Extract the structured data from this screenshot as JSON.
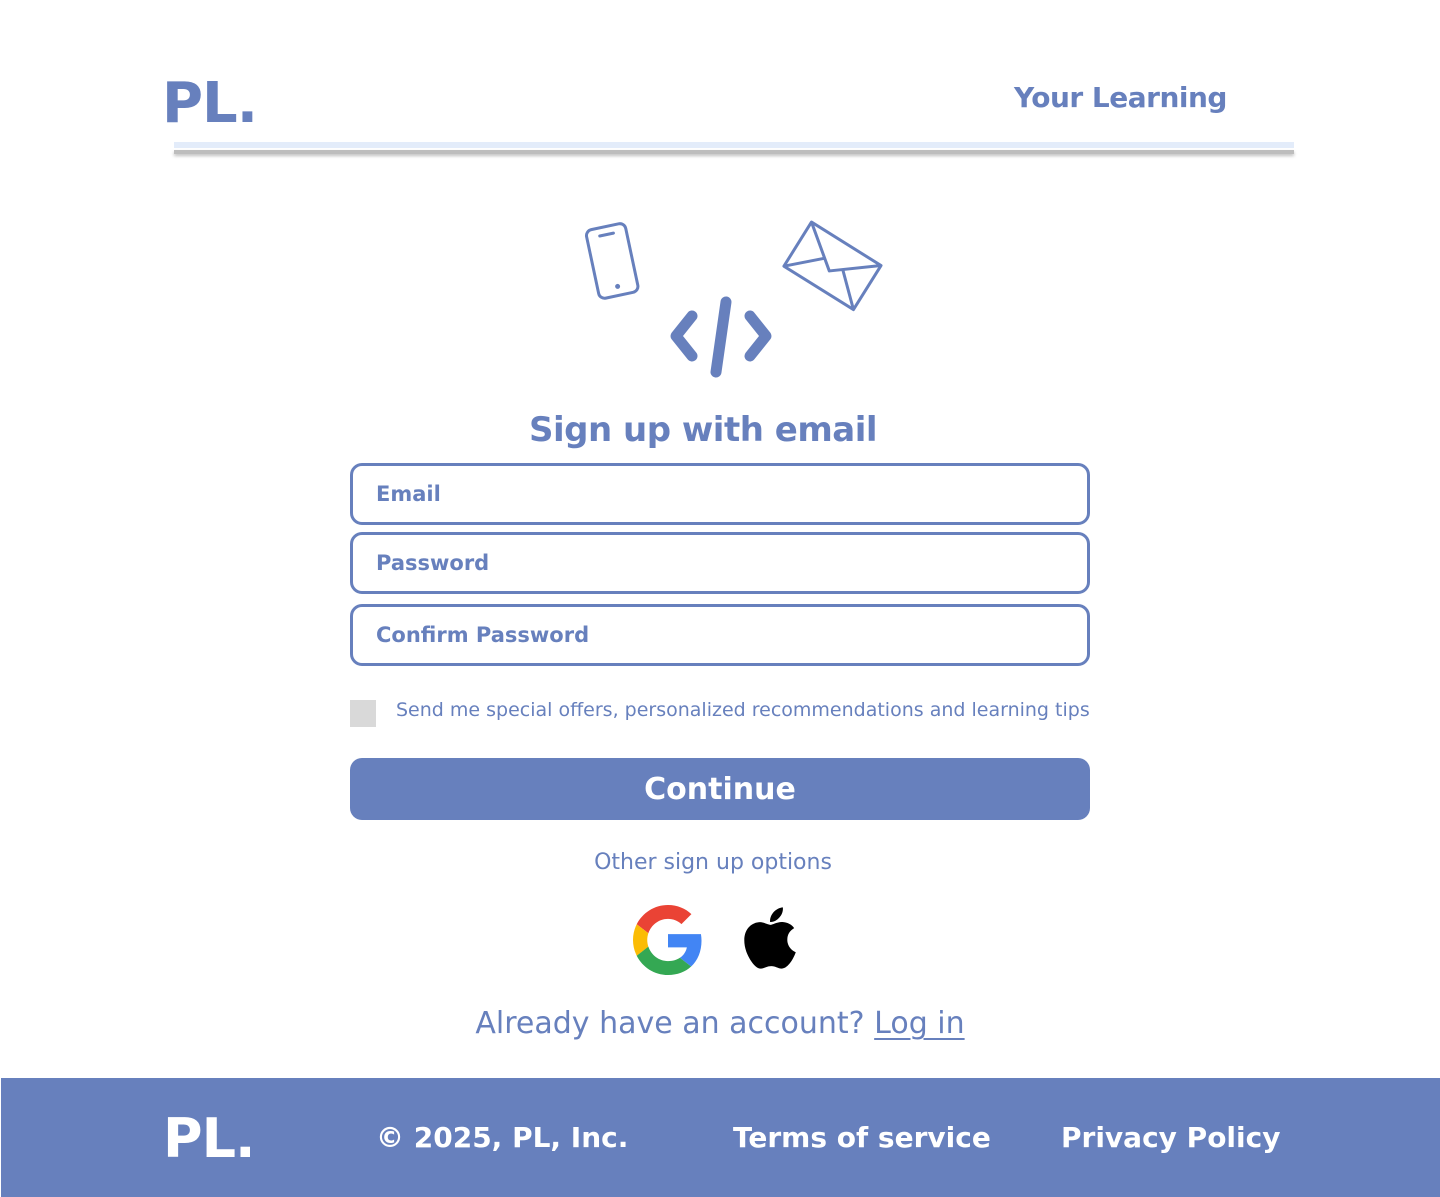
{
  "header": {
    "logo": "PL.",
    "nav_link": "Your Learning"
  },
  "hero": {
    "icons": [
      "phone-icon",
      "envelope-icon",
      "code-icon"
    ]
  },
  "form": {
    "title": "Sign up with email",
    "email_placeholder": "Email",
    "password_placeholder": "Password",
    "confirm_placeholder": "Confirm Password",
    "optin_label": "Send me special offers, personalized recommendations and learning tips",
    "optin_checked": false,
    "continue_label": "Continue"
  },
  "social": {
    "heading": "Other sign up options",
    "providers": [
      "google-icon",
      "apple-icon"
    ]
  },
  "login": {
    "prompt": "Already have an account?",
    "link": "Log in"
  },
  "footer": {
    "logo": "PL.",
    "copyright": "© 2025, PL, Inc.",
    "terms": "Terms of service",
    "privacy": "Privacy Policy"
  },
  "colors": {
    "accent": "#6780bd",
    "checkbox": "#d9d9d9",
    "background": "#ffffff"
  }
}
